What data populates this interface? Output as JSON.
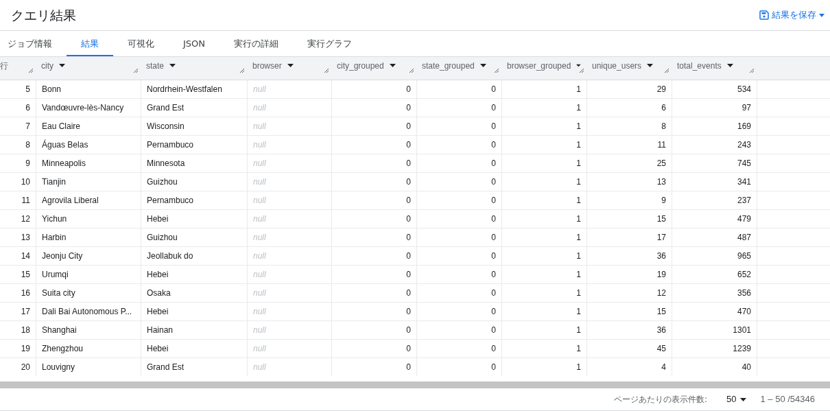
{
  "title": "クエリ結果",
  "save_button": "結果を保存",
  "tabs": [
    {
      "label": "ジョブ情報",
      "selected": false
    },
    {
      "label": "結果",
      "selected": true
    },
    {
      "label": "可視化",
      "selected": false
    },
    {
      "label": "JSON",
      "selected": false
    },
    {
      "label": "実行の詳細",
      "selected": false
    },
    {
      "label": "実行グラフ",
      "selected": false
    }
  ],
  "table": {
    "columns": [
      {
        "label": "行",
        "kind": "index"
      },
      {
        "label": "city",
        "kind": "text"
      },
      {
        "label": "state",
        "kind": "text"
      },
      {
        "label": "browser",
        "kind": "text"
      },
      {
        "label": "city_grouped",
        "kind": "number"
      },
      {
        "label": "state_grouped",
        "kind": "number"
      },
      {
        "label": "browser_grouped",
        "kind": "number"
      },
      {
        "label": "unique_users",
        "kind": "number"
      },
      {
        "label": "total_events",
        "kind": "number"
      }
    ],
    "rows": [
      {
        "cells": [
          "5",
          "Bonn",
          "Nordrhein-Westfalen",
          {
            "text": "null",
            "is_null": true
          },
          "0",
          "0",
          "1",
          "29",
          "534"
        ]
      },
      {
        "cells": [
          "6",
          "Vandœuvre-lès-Nancy",
          "Grand Est",
          {
            "text": "null",
            "is_null": true
          },
          "0",
          "0",
          "1",
          "6",
          "97"
        ]
      },
      {
        "cells": [
          "7",
          "Eau Claire",
          "Wisconsin",
          {
            "text": "null",
            "is_null": true
          },
          "0",
          "0",
          "1",
          "8",
          "169"
        ]
      },
      {
        "cells": [
          "8",
          "Águas Belas",
          "Pernambuco",
          {
            "text": "null",
            "is_null": true
          },
          "0",
          "0",
          "1",
          "11",
          "243"
        ]
      },
      {
        "cells": [
          "9",
          "Minneapolis",
          "Minnesota",
          {
            "text": "null",
            "is_null": true
          },
          "0",
          "0",
          "1",
          "25",
          "745"
        ]
      },
      {
        "cells": [
          "10",
          "Tianjin",
          "Guizhou",
          {
            "text": "null",
            "is_null": true
          },
          "0",
          "0",
          "1",
          "13",
          "341"
        ]
      },
      {
        "cells": [
          "11",
          "Agrovila Liberal",
          "Pernambuco",
          {
            "text": "null",
            "is_null": true
          },
          "0",
          "0",
          "1",
          "9",
          "237"
        ]
      },
      {
        "cells": [
          "12",
          "Yichun",
          "Hebei",
          {
            "text": "null",
            "is_null": true
          },
          "0",
          "0",
          "1",
          "15",
          "479"
        ]
      },
      {
        "cells": [
          "13",
          "Harbin",
          "Guizhou",
          {
            "text": "null",
            "is_null": true
          },
          "0",
          "0",
          "1",
          "17",
          "487"
        ]
      },
      {
        "cells": [
          "14",
          "Jeonju City",
          "Jeollabuk do",
          {
            "text": "null",
            "is_null": true
          },
          "0",
          "0",
          "1",
          "36",
          "965"
        ]
      },
      {
        "cells": [
          "15",
          "Urumqi",
          "Hebei",
          {
            "text": "null",
            "is_null": true
          },
          "0",
          "0",
          "1",
          "19",
          "652"
        ]
      },
      {
        "cells": [
          "16",
          "Suita city",
          "Osaka",
          {
            "text": "null",
            "is_null": true
          },
          "0",
          "0",
          "1",
          "12",
          "356"
        ]
      },
      {
        "cells": [
          "17",
          "Dali Bai Autonomous P...",
          "Hebei",
          {
            "text": "null",
            "is_null": true
          },
          "0",
          "0",
          "1",
          "15",
          "470"
        ]
      },
      {
        "cells": [
          "18",
          "Shanghai",
          "Hainan",
          {
            "text": "null",
            "is_null": true
          },
          "0",
          "0",
          "1",
          "36",
          "1301"
        ]
      },
      {
        "cells": [
          "19",
          "Zhengzhou",
          "Hebei",
          {
            "text": "null",
            "is_null": true
          },
          "0",
          "0",
          "1",
          "45",
          "1239"
        ]
      },
      {
        "cells": [
          "20",
          "Louvigny",
          "Grand Est",
          {
            "text": "null",
            "is_null": true
          },
          "0",
          "0",
          "1",
          "4",
          "40"
        ]
      }
    ]
  },
  "footer": {
    "page_size_label": "ページあたりの表示件数:",
    "page_size": "50",
    "range": "1 – 50 /54346"
  }
}
